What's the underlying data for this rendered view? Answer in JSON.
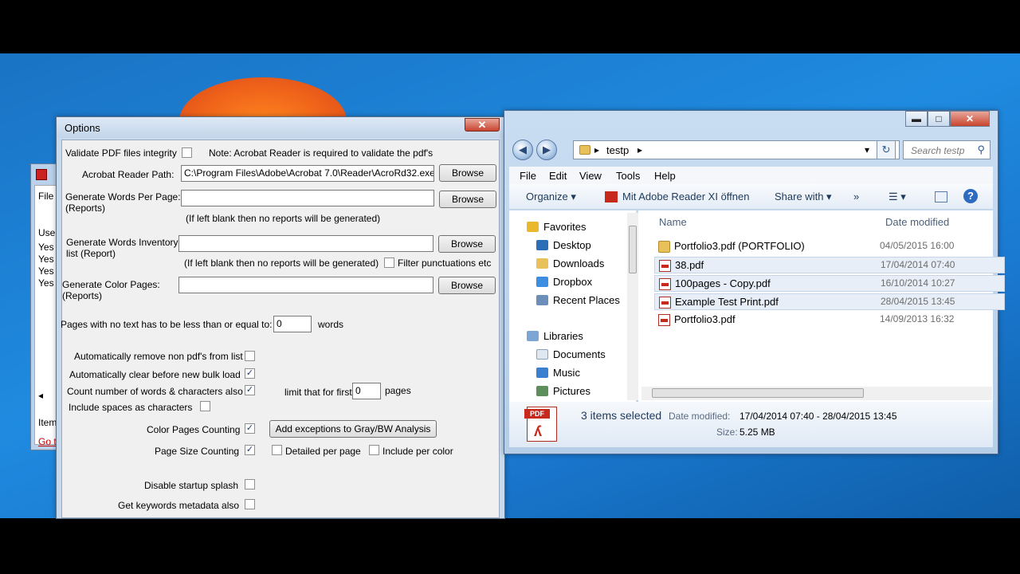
{
  "options": {
    "title": "Options",
    "close_glyph": "✕",
    "validate_label": "Validate PDF files integrity",
    "validate_note": "Note: Acrobat Reader is required to validate the pdf's",
    "reader_path_label": "Acrobat Reader Path:",
    "reader_path_value": "C:\\Program Files\\Adobe\\Acrobat 7.0\\Reader\\AcroRd32.exe",
    "browse_label": "Browse",
    "words_per_page_label_1": "Generate Words Per Page:",
    "words_per_page_label_2": "(Reports)",
    "blank_note": "(If left blank then no reports will be generated)",
    "inventory_label_1": "Generate Words Inventory",
    "inventory_label_2": "list (Report)",
    "filter_punct_label": "Filter punctuations etc",
    "color_pages_label_1": "Generate Color Pages:",
    "color_pages_label_2": "(Reports)",
    "no_text_label": "Pages with no text has to be less than or equal to:",
    "no_text_value": "0",
    "no_text_unit": "words",
    "auto_remove_label": "Automatically remove non pdf's from list",
    "auto_clear_label": "Automatically clear before new bulk load",
    "count_words_label": "Count number of words & characters also",
    "limit_label": "limit that for first",
    "limit_value": "0",
    "limit_unit": "pages",
    "include_spaces_label": "Include spaces as characters",
    "color_counting_label": "Color Pages Counting",
    "add_exceptions_label": "Add exceptions to Gray/BW Analysis",
    "page_size_label": "Page Size Counting",
    "detailed_label": "Detailed per page",
    "include_color_label": "Include per color",
    "disable_splash_label": "Disable startup splash",
    "keywords_label": "Get keywords metadata also",
    "check_mark": "✓"
  },
  "bg_window": {
    "file": "File",
    "col": "Use",
    "rows": [
      "Yes",
      "Yes",
      "Yes",
      "Yes"
    ],
    "item": "Item",
    "goto": "Go t",
    "arrow": "◂"
  },
  "explorer": {
    "min_glyph": "▬",
    "max_glyph": "□",
    "close_glyph": "✕",
    "back_glyph": "◀",
    "fwd_glyph": "▶",
    "path": "testp",
    "chevron": "▸",
    "dropdown": "▾",
    "search_placeholder": "Search testp",
    "search_glyph": "⚲",
    "refresh_glyph": "↻",
    "menu": {
      "file": "File",
      "edit": "Edit",
      "view": "View",
      "tools": "Tools",
      "help": "Help"
    },
    "cmd": {
      "organize": "Organize ▾",
      "open_with": "Mit Adobe Reader XI öffnen",
      "share": "Share with ▾",
      "more": "»",
      "views": "☰ ▾",
      "help": "?"
    },
    "nav": {
      "favorites": "Favorites",
      "desktop": "Desktop",
      "downloads": "Downloads",
      "dropbox": "Dropbox",
      "recent": "Recent Places",
      "libraries": "Libraries",
      "documents": "Documents",
      "music": "Music",
      "pictures": "Pictures"
    },
    "columns": {
      "name": "Name",
      "date": "Date modified"
    },
    "files": [
      {
        "name": "Portfolio3.pdf (PORTFOLIO)",
        "date": "04/05/2015 16:00",
        "kind": "folder",
        "selected": false
      },
      {
        "name": "38.pdf",
        "date": "17/04/2014 07:40",
        "kind": "pdf",
        "selected": true
      },
      {
        "name": "100pages - Copy.pdf",
        "date": "16/10/2014 10:27",
        "kind": "pdf",
        "selected": true
      },
      {
        "name": "Example Test Print.pdf",
        "date": "28/04/2015 13:45",
        "kind": "pdf",
        "selected": true
      },
      {
        "name": "Portfolio3.pdf",
        "date": "14/09/2013 16:32",
        "kind": "pdf",
        "selected": false
      }
    ],
    "status": {
      "selected": "3 items selected",
      "date_label": "Date modified:",
      "date_value": "17/04/2014 07:40 - 28/04/2015 13:45",
      "size_label": "Size:",
      "size_value": "5.25 MB",
      "pdf_tag": "PDF"
    }
  },
  "colors": {
    "desktop": "#1f8be0",
    "pdf_red": "#c8291d",
    "selection": "#e7eef7"
  }
}
